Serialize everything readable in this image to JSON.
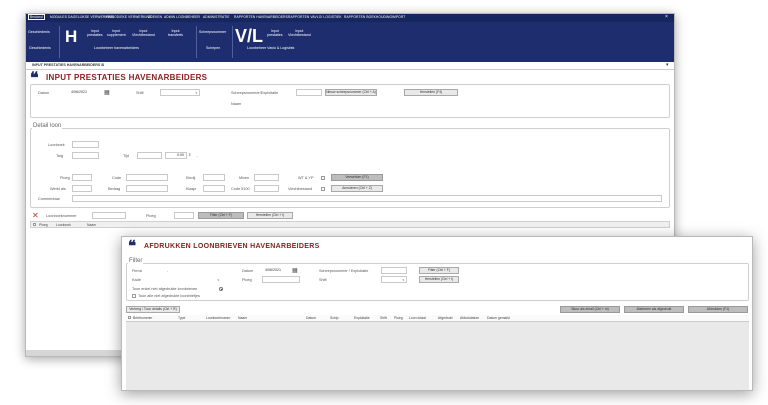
{
  "menu": {
    "items": [
      {
        "label": "Bestand",
        "active": true
      },
      {
        "label": "MODULES"
      },
      {
        "label": "DAGELIJKSE VERWERKING"
      },
      {
        "label": "PERIODIEKE VERWERKING"
      },
      {
        "label": "ZOEKEN"
      },
      {
        "label": "ADMIN LOONBEHEER"
      },
      {
        "label": "ADMINISTRATIE"
      },
      {
        "label": "RAPPORTEN HAVENARBEIDERS"
      },
      {
        "label": "RAPPORTEN VAVLO/ LOGISTIEK"
      },
      {
        "label": "RAPPORTEN BOEKHOUDING"
      },
      {
        "label": "IMPORT"
      }
    ],
    "close_glyph": "×"
  },
  "ribbon": {
    "geschiedenis_top": "Geschiedenis",
    "geschiedenis_bottom": "Geschiedenis",
    "h_letter": "H",
    "h_buttons": [
      "Input\nprestaties",
      "Input\nsupplement",
      "Input\nVlechtbestand",
      "Input\ntransferts"
    ],
    "h_group": "Loonbeheer havenarbeiders",
    "scheepsnummer": "Scheepsnummer",
    "schepen": "Schepen",
    "vl_letter": "V/L",
    "vl_buttons": [
      "Input\nprestaties",
      "Input\nVlechtbestand"
    ],
    "vl_group": "Loonbeheer Vavlo & Logistiek"
  },
  "tab": {
    "label": "INPUT PRESTATIES HAVENARBEIDERS",
    "close": "⊠",
    "pin": "▾"
  },
  "page1": {
    "title": "INPUT PRESTATIES HAVENARBEIDERS",
    "datum_label": "Datum",
    "datum_value": "4/06/2021",
    "calendar_glyph": "▦",
    "shift_label": "Shift",
    "scheeps_label": "Scheepsnummer/Exploitatie",
    "nieuw_btn": "Nieuw scheepsnummer (Ctrl + A)",
    "herstellen_btn": "Herstellen (F4)",
    "naam_label": "Naam",
    "detail_legend": "Detail loon",
    "loonboek_label": "Loonboek",
    "taig_label": "Taig",
    "tijd_label": "Tijd",
    "tijd_value": "0:00",
    "ploeg_label": "Ploeg",
    "code_label": "Code",
    "kledij_label": "Kledij",
    "mixen_label": "Mixen",
    "wt_label": "WT & YP",
    "verwerken_btn": "Verwerken (F1)",
    "werkt_label": "Werkt als",
    "bedrag_label": "Bedrag",
    "klasje_label": "Klasje",
    "code5100_label": "Code 5100",
    "vlecht_label": "Vlechtbestand",
    "annuleren_btn": "Annuleren (Ctrl + Z)",
    "commentaar_label": "Commentaar",
    "x_glyph": "✕",
    "loonboeknummer_label": "Loonboeknummer",
    "ploeg2_label": "Ploeg",
    "filter_btn": "Filter (Ctrl + F)",
    "herstellen2_btn": "Herstellen (Ctrl + I)",
    "grid_cols": [
      "Ploeg",
      "Loonboek",
      "Naam"
    ]
  },
  "page2": {
    "title": "AFDRUKKEN LOONBRIEVEN HAVENARBEIDERS",
    "filter_legend": "Filter",
    "firma_label": "Firma",
    "firma_value": "-",
    "kade_label": "Kade",
    "datum_label": "Datum",
    "datum_value": "4/06/2021",
    "calendar_glyph": "▦",
    "ploeg_label": "Ploeg",
    "scheeps_label": "Scheepsnummer / Exploitatie",
    "shift_label": "Shift",
    "filter_btn": "Filter (Ctrl + F)",
    "herstellen_btn": "Herstellen (Ctrl + I)",
    "radio_label": "Toon enkel niet afgedrukte loonbrieven",
    "check_label": "Toon alle niet afgedrukte loonbriefjes",
    "verberg_btn": "Verberg / Toon details (Ctrl + R)",
    "stuur_btn": "Stuur als email (Ctrl + m)",
    "markeren_btn": "Markeren als afgedrukt",
    "afdrukken_btn": "Afdrukken (F1)",
    "grid_cols": [
      "Briefnummer",
      "Type",
      "Loonboeknumm",
      "Naam",
      "Datum",
      "Schip",
      "Exploitatie",
      "Shift",
      "Ploeg",
      "Loon totaal",
      "Afgedrukt",
      "Afdrukdatum",
      "Datum gemaild"
    ]
  },
  "colors": {
    "nav": "#1d2d6e",
    "title": "#8b1c1c",
    "accent_x": "#c0392b"
  }
}
